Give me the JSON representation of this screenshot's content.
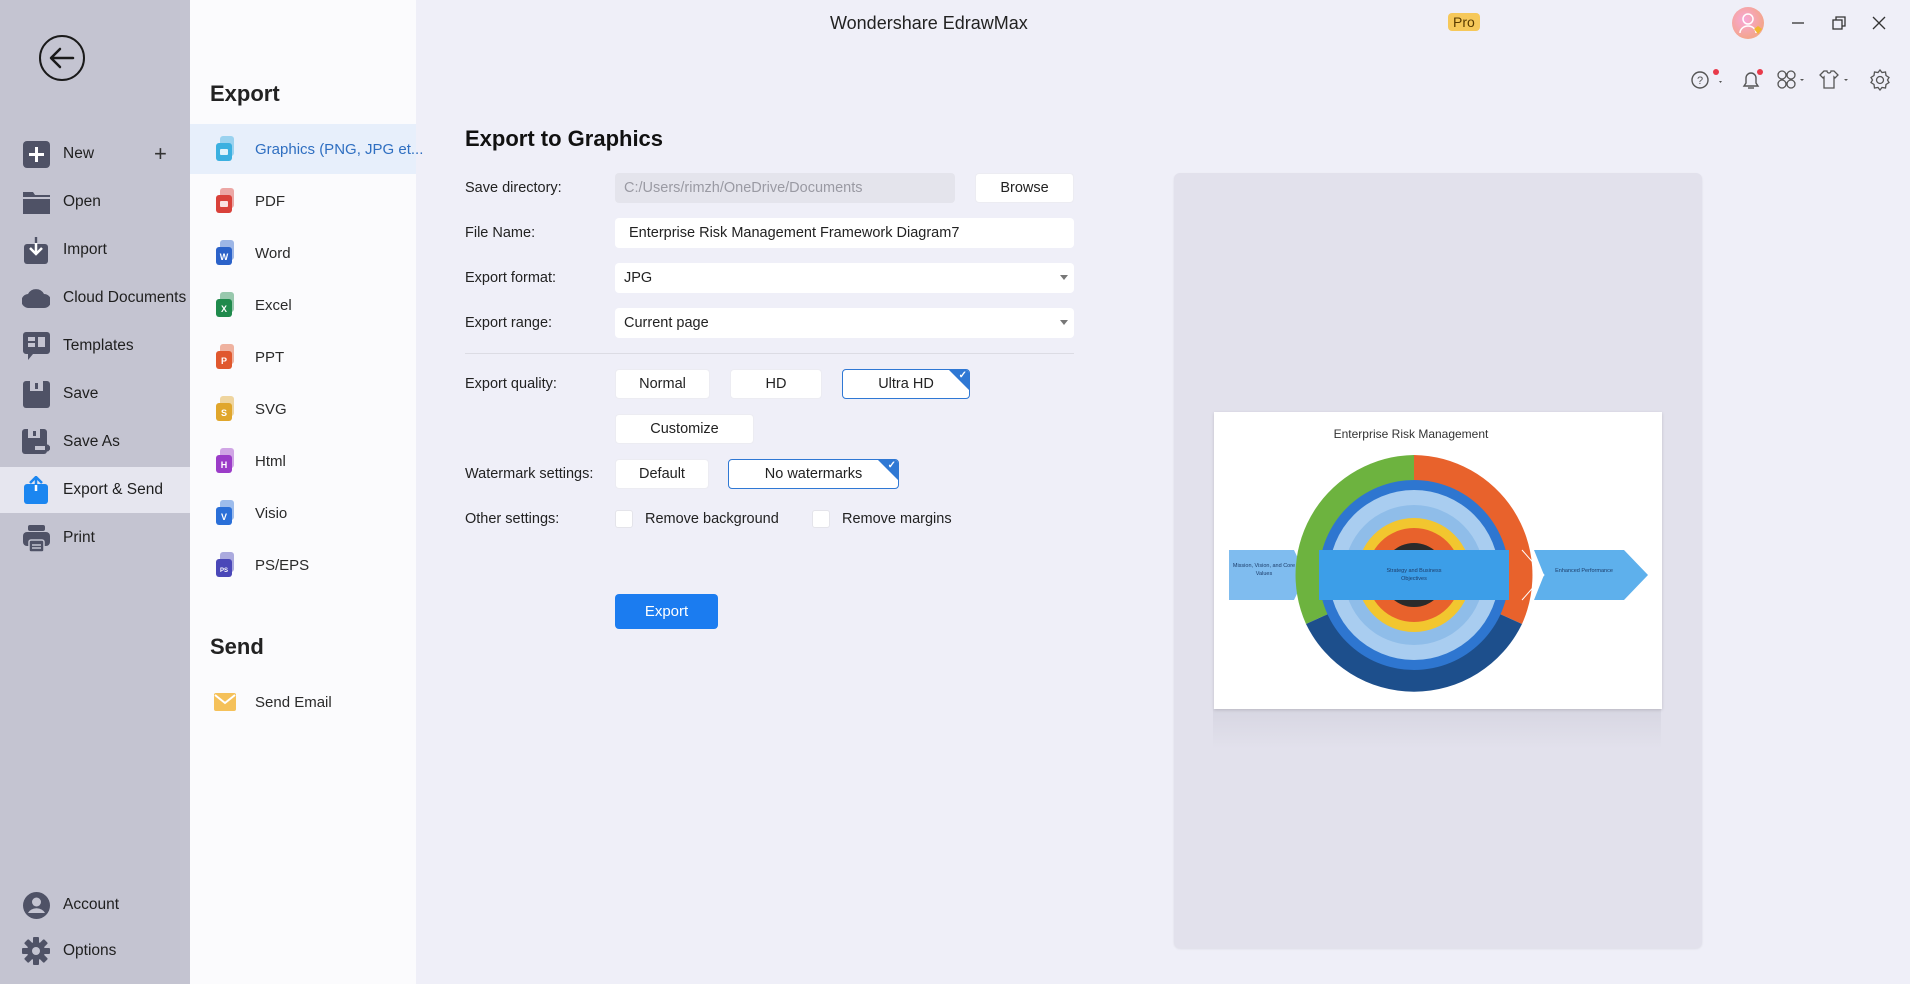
{
  "app": {
    "title": "Wondershare EdrawMax",
    "badge": "Pro"
  },
  "left_nav": {
    "items": [
      {
        "label": "New",
        "icon": "plus-square-icon"
      },
      {
        "label": "Open",
        "icon": "folder-icon"
      },
      {
        "label": "Import",
        "icon": "import-icon"
      },
      {
        "label": "Cloud Documents",
        "icon": "cloud-icon"
      },
      {
        "label": "Templates",
        "icon": "templates-icon"
      },
      {
        "label": "Save",
        "icon": "save-icon"
      },
      {
        "label": "Save As",
        "icon": "save-as-icon"
      },
      {
        "label": "Export & Send",
        "icon": "export-icon",
        "active": true
      },
      {
        "label": "Print",
        "icon": "print-icon"
      }
    ],
    "bottom": [
      {
        "label": "Account",
        "icon": "account-icon"
      },
      {
        "label": "Options",
        "icon": "gear-icon"
      }
    ]
  },
  "submenu": {
    "export_heading": "Export",
    "export_items": [
      {
        "label": "Graphics (PNG, JPG et...",
        "color": "#3bb0e0",
        "letter": "",
        "active": true
      },
      {
        "label": "PDF",
        "color": "#d9413a",
        "letter": ""
      },
      {
        "label": "Word",
        "color": "#2b62c9",
        "letter": "W"
      },
      {
        "label": "Excel",
        "color": "#1f8a4c",
        "letter": "X"
      },
      {
        "label": "PPT",
        "color": "#e0582e",
        "letter": "P"
      },
      {
        "label": "SVG",
        "color": "#e0a62c",
        "letter": "S"
      },
      {
        "label": "Html",
        "color": "#9b3cc8",
        "letter": "H"
      },
      {
        "label": "Visio",
        "color": "#2a6fd8",
        "letter": "V"
      },
      {
        "label": "PS/EPS",
        "color": "#4a47b8",
        "letter": "PS"
      }
    ],
    "send_heading": "Send",
    "send_items": [
      {
        "label": "Send Email",
        "color": "#f5c15a"
      }
    ]
  },
  "form": {
    "title": "Export to Graphics",
    "save_directory": {
      "label": "Save directory:",
      "value": "C:/Users/rimzh/OneDrive/Documents",
      "browse": "Browse"
    },
    "file_name": {
      "label": "File Name:",
      "value": "Enterprise Risk Management Framework Diagram7"
    },
    "export_format": {
      "label": "Export format:",
      "value": "JPG"
    },
    "export_range": {
      "label": "Export range:",
      "value": "Current page"
    },
    "export_quality": {
      "label": "Export quality:",
      "options": [
        "Normal",
        "HD",
        "Ultra HD",
        "Customize"
      ],
      "selected": "Ultra HD"
    },
    "watermark": {
      "label": "Watermark settings:",
      "options": [
        "Default",
        "No watermarks"
      ],
      "selected": "No watermarks"
    },
    "other": {
      "label": "Other settings:",
      "remove_background": "Remove background",
      "remove_margins": "Remove margins",
      "remove_background_checked": false,
      "remove_margins_checked": false
    },
    "export_button": "Export"
  },
  "preview": {
    "diagram_title": "Enterprise Risk Management",
    "left_arrow": "Mission, Vision, and Core Values",
    "center_band": "Strategy and Business Objectives",
    "right_arrow": "Enhanced Performance",
    "colors": {
      "green": "#6db33f",
      "orange": "#e8622c",
      "navy": "#1d4f8c",
      "blue": "#2e76d0",
      "light_blue": "#a9cdf0",
      "yellow": "#f2c62f",
      "dark": "#2b2b2b",
      "band": "#3c9ee8",
      "arrow": "#5eb0ec"
    }
  },
  "colors": {
    "accent": "#1b7cf0",
    "nav_bg": "#c4c4d1",
    "selected_border": "#2f78d4"
  }
}
